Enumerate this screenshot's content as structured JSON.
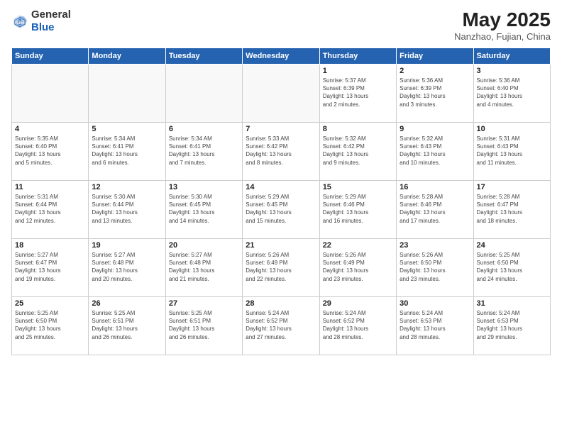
{
  "logo": {
    "general": "General",
    "blue": "Blue"
  },
  "title": {
    "month_year": "May 2025",
    "location": "Nanzhao, Fujian, China"
  },
  "weekdays": [
    "Sunday",
    "Monday",
    "Tuesday",
    "Wednesday",
    "Thursday",
    "Friday",
    "Saturday"
  ],
  "weeks": [
    [
      {
        "day": "",
        "info": ""
      },
      {
        "day": "",
        "info": ""
      },
      {
        "day": "",
        "info": ""
      },
      {
        "day": "",
        "info": ""
      },
      {
        "day": "1",
        "info": "Sunrise: 5:37 AM\nSunset: 6:39 PM\nDaylight: 13 hours\nand 2 minutes."
      },
      {
        "day": "2",
        "info": "Sunrise: 5:36 AM\nSunset: 6:39 PM\nDaylight: 13 hours\nand 3 minutes."
      },
      {
        "day": "3",
        "info": "Sunrise: 5:36 AM\nSunset: 6:40 PM\nDaylight: 13 hours\nand 4 minutes."
      }
    ],
    [
      {
        "day": "4",
        "info": "Sunrise: 5:35 AM\nSunset: 6:40 PM\nDaylight: 13 hours\nand 5 minutes."
      },
      {
        "day": "5",
        "info": "Sunrise: 5:34 AM\nSunset: 6:41 PM\nDaylight: 13 hours\nand 6 minutes."
      },
      {
        "day": "6",
        "info": "Sunrise: 5:34 AM\nSunset: 6:41 PM\nDaylight: 13 hours\nand 7 minutes."
      },
      {
        "day": "7",
        "info": "Sunrise: 5:33 AM\nSunset: 6:42 PM\nDaylight: 13 hours\nand 8 minutes."
      },
      {
        "day": "8",
        "info": "Sunrise: 5:32 AM\nSunset: 6:42 PM\nDaylight: 13 hours\nand 9 minutes."
      },
      {
        "day": "9",
        "info": "Sunrise: 5:32 AM\nSunset: 6:43 PM\nDaylight: 13 hours\nand 10 minutes."
      },
      {
        "day": "10",
        "info": "Sunrise: 5:31 AM\nSunset: 6:43 PM\nDaylight: 13 hours\nand 11 minutes."
      }
    ],
    [
      {
        "day": "11",
        "info": "Sunrise: 5:31 AM\nSunset: 6:44 PM\nDaylight: 13 hours\nand 12 minutes."
      },
      {
        "day": "12",
        "info": "Sunrise: 5:30 AM\nSunset: 6:44 PM\nDaylight: 13 hours\nand 13 minutes."
      },
      {
        "day": "13",
        "info": "Sunrise: 5:30 AM\nSunset: 6:45 PM\nDaylight: 13 hours\nand 14 minutes."
      },
      {
        "day": "14",
        "info": "Sunrise: 5:29 AM\nSunset: 6:45 PM\nDaylight: 13 hours\nand 15 minutes."
      },
      {
        "day": "15",
        "info": "Sunrise: 5:29 AM\nSunset: 6:46 PM\nDaylight: 13 hours\nand 16 minutes."
      },
      {
        "day": "16",
        "info": "Sunrise: 5:28 AM\nSunset: 6:46 PM\nDaylight: 13 hours\nand 17 minutes."
      },
      {
        "day": "17",
        "info": "Sunrise: 5:28 AM\nSunset: 6:47 PM\nDaylight: 13 hours\nand 18 minutes."
      }
    ],
    [
      {
        "day": "18",
        "info": "Sunrise: 5:27 AM\nSunset: 6:47 PM\nDaylight: 13 hours\nand 19 minutes."
      },
      {
        "day": "19",
        "info": "Sunrise: 5:27 AM\nSunset: 6:48 PM\nDaylight: 13 hours\nand 20 minutes."
      },
      {
        "day": "20",
        "info": "Sunrise: 5:27 AM\nSunset: 6:48 PM\nDaylight: 13 hours\nand 21 minutes."
      },
      {
        "day": "21",
        "info": "Sunrise: 5:26 AM\nSunset: 6:49 PM\nDaylight: 13 hours\nand 22 minutes."
      },
      {
        "day": "22",
        "info": "Sunrise: 5:26 AM\nSunset: 6:49 PM\nDaylight: 13 hours\nand 23 minutes."
      },
      {
        "day": "23",
        "info": "Sunrise: 5:26 AM\nSunset: 6:50 PM\nDaylight: 13 hours\nand 23 minutes."
      },
      {
        "day": "24",
        "info": "Sunrise: 5:25 AM\nSunset: 6:50 PM\nDaylight: 13 hours\nand 24 minutes."
      }
    ],
    [
      {
        "day": "25",
        "info": "Sunrise: 5:25 AM\nSunset: 6:50 PM\nDaylight: 13 hours\nand 25 minutes."
      },
      {
        "day": "26",
        "info": "Sunrise: 5:25 AM\nSunset: 6:51 PM\nDaylight: 13 hours\nand 26 minutes."
      },
      {
        "day": "27",
        "info": "Sunrise: 5:25 AM\nSunset: 6:51 PM\nDaylight: 13 hours\nand 26 minutes."
      },
      {
        "day": "28",
        "info": "Sunrise: 5:24 AM\nSunset: 6:52 PM\nDaylight: 13 hours\nand 27 minutes."
      },
      {
        "day": "29",
        "info": "Sunrise: 5:24 AM\nSunset: 6:52 PM\nDaylight: 13 hours\nand 28 minutes."
      },
      {
        "day": "30",
        "info": "Sunrise: 5:24 AM\nSunset: 6:53 PM\nDaylight: 13 hours\nand 28 minutes."
      },
      {
        "day": "31",
        "info": "Sunrise: 5:24 AM\nSunset: 6:53 PM\nDaylight: 13 hours\nand 29 minutes."
      }
    ]
  ]
}
